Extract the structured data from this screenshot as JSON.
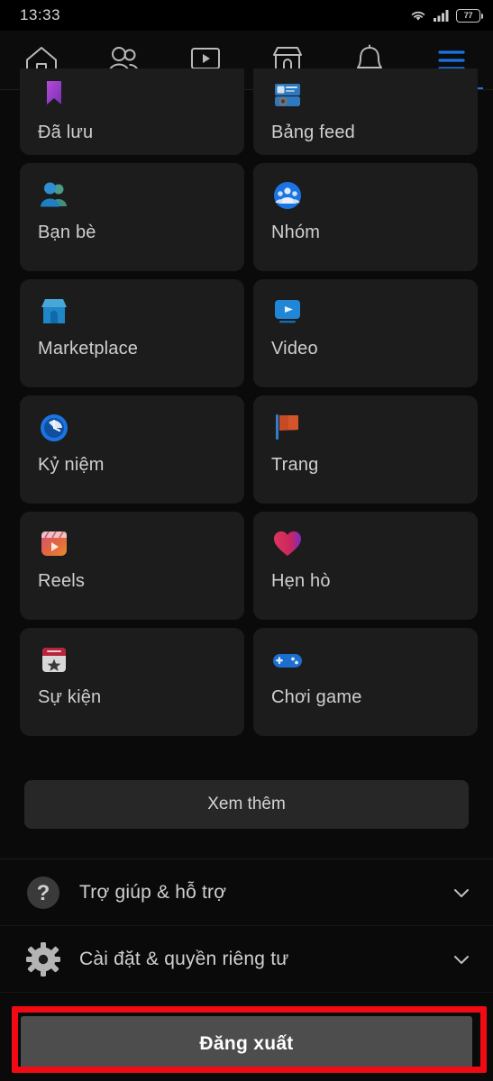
{
  "status_bar": {
    "time": "13:33",
    "battery_level": "77",
    "icons": [
      "wifi-icon",
      "cellular-signal-icon",
      "battery-icon"
    ]
  },
  "top_nav": {
    "tabs": [
      {
        "name": "home",
        "icon": "home-icon",
        "active": false
      },
      {
        "name": "friends",
        "icon": "friends-icon",
        "active": false
      },
      {
        "name": "video",
        "icon": "video-icon",
        "active": false
      },
      {
        "name": "marketplace",
        "icon": "marketplace-icon",
        "active": false
      },
      {
        "name": "notifications",
        "icon": "bell-icon",
        "active": false
      },
      {
        "name": "menu",
        "icon": "hamburger-menu-icon",
        "active": true
      }
    ],
    "active_color": "#1b74e4"
  },
  "shortcuts": [
    {
      "label": "Đã lưu",
      "icon": "bookmark-icon",
      "clipped": true
    },
    {
      "label": "Bảng feed",
      "icon": "news-feed-icon",
      "clipped": true
    },
    {
      "label": "Bạn bè",
      "icon": "friends-icon",
      "clipped": false
    },
    {
      "label": "Nhóm",
      "icon": "groups-icon",
      "clipped": false
    },
    {
      "label": "Marketplace",
      "icon": "marketplace-icon",
      "clipped": false
    },
    {
      "label": "Video",
      "icon": "video-icon",
      "clipped": false
    },
    {
      "label": "Kỷ niệm",
      "icon": "memories-icon",
      "clipped": false
    },
    {
      "label": "Trang",
      "icon": "pages-flag-icon",
      "clipped": false
    },
    {
      "label": "Reels",
      "icon": "reels-icon",
      "clipped": false
    },
    {
      "label": "Hẹn hò",
      "icon": "dating-heart-icon",
      "clipped": false
    },
    {
      "label": "Sự kiện",
      "icon": "events-icon",
      "clipped": false
    },
    {
      "label": "Chơi game",
      "icon": "gaming-icon",
      "clipped": false
    }
  ],
  "see_more": {
    "label": "Xem thêm"
  },
  "menu_rows": [
    {
      "label": "Trợ giúp & hỗ trợ",
      "icon": "help-circle-icon",
      "chevron": "chevron-down-icon"
    },
    {
      "label": "Cài đặt & quyền riêng tư",
      "icon": "gear-icon",
      "chevron": "chevron-down-icon"
    }
  ],
  "logout": {
    "label": "Đăng xuất"
  },
  "annotation": {
    "type": "highlight-rectangle",
    "color": "#f10a13",
    "target": "logout-button"
  }
}
